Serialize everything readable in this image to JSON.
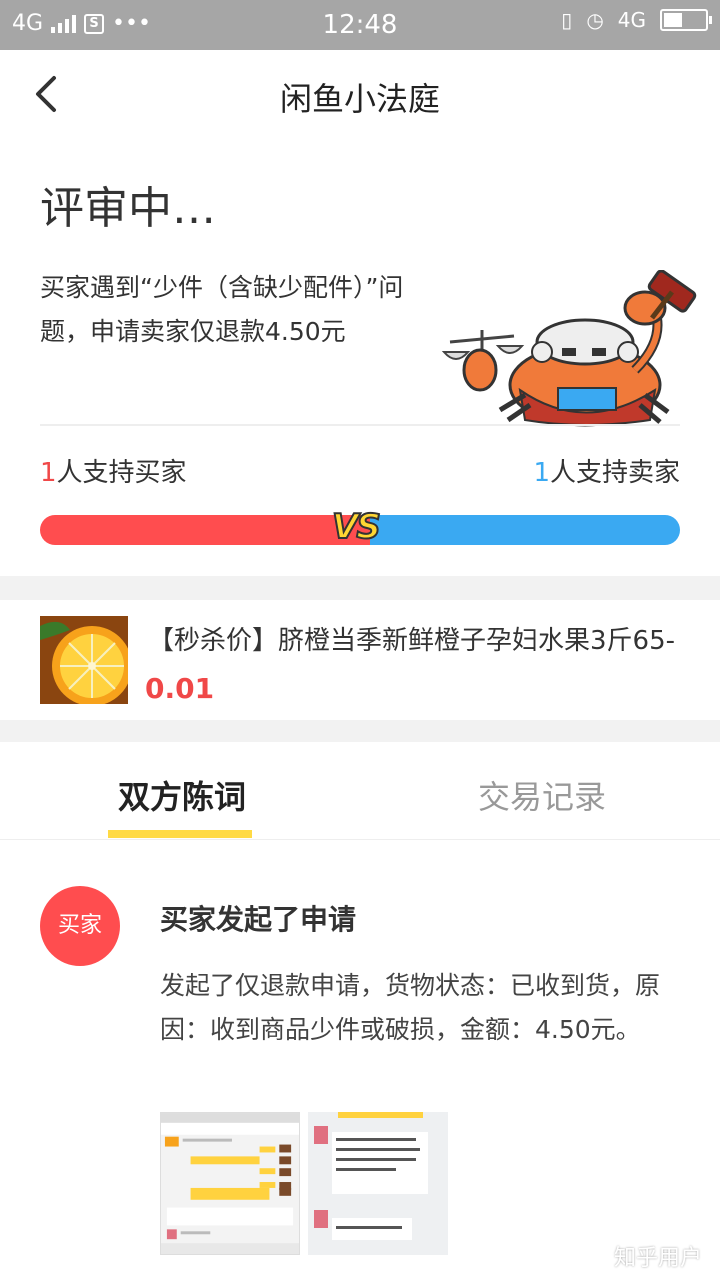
{
  "status_bar": {
    "network": "4G",
    "time": "12:48",
    "network_right": "4G"
  },
  "nav": {
    "title": "闲鱼小法庭",
    "back_icon": "chevron-left-icon"
  },
  "case": {
    "status": "评审中…",
    "description": "买家遇到“少件（含缺少配件）”问题，申请卖家仅退款4.50元",
    "buyer_support_count": "1",
    "buyer_support_label": "人支持买家",
    "seller_support_count": "1",
    "seller_support_label": "人支持卖家",
    "buyer_share": 0.5,
    "vs_label": "VS",
    "colors": {
      "buyer": "#ff4d4f",
      "seller": "#3aa9f2",
      "accent": "#ffda44"
    }
  },
  "product": {
    "title": "【秒杀价】脐橙当季新鲜橙子孕妇水果3斤65-",
    "price": "0.01"
  },
  "tabs": [
    {
      "label": "双方陈词",
      "active": true
    },
    {
      "label": "交易记录",
      "active": false
    }
  ],
  "event": {
    "avatar_label": "买家",
    "title": "买家发起了申请",
    "description": "发起了仅退款申请，货物状态：已收到货，原因：收到商品少件或破损，金额：4.50元。"
  },
  "watermark": "知乎用户"
}
